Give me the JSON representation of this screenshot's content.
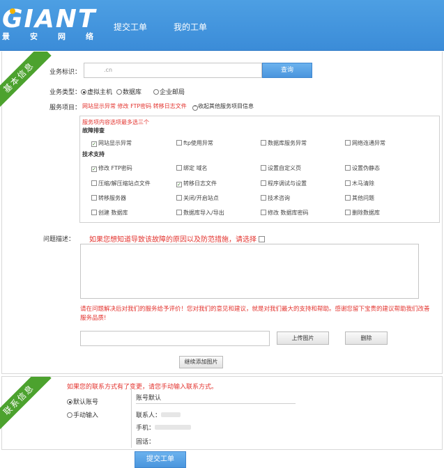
{
  "header": {
    "logo_text": "GIANT",
    "logo_sub": "景安网络",
    "nav": [
      "提交工单",
      "我的工单"
    ]
  },
  "basic": {
    "ribbon": "基本信息",
    "biz_id_label": "业务标识：",
    "biz_id_value": ".cn",
    "query_button": "查询",
    "biz_type_label": "业务类型：",
    "biz_types": [
      {
        "label": "虚拟主机",
        "checked": true
      },
      {
        "label": "数据库",
        "checked": false
      },
      {
        "label": "企业邮局",
        "checked": false
      }
    ],
    "service_label": "服务项目：",
    "service_selected": "网站显示异常 修改 FTP密码 转移日志文件",
    "service_collapse": "收起其他服务项目信息",
    "service_hint": "服务项内容选项最多选三个",
    "group_fault": "故障排查",
    "group_tech": "技术支持",
    "fault_items": [
      {
        "label": "网站显示异常",
        "checked": true
      },
      {
        "label": "ftp使用异常",
        "checked": false
      },
      {
        "label": "数据库服务异常",
        "checked": false
      },
      {
        "label": "网络连通异常",
        "checked": false
      }
    ],
    "tech_items": [
      {
        "label": "修改 FTP密码",
        "checked": true
      },
      {
        "label": "绑定 域名",
        "checked": false
      },
      {
        "label": "设置自定义页",
        "checked": false
      },
      {
        "label": "设置伪静态",
        "checked": false
      },
      {
        "label": "压缩/解压缩站点文件",
        "checked": false
      },
      {
        "label": "转移日志文件",
        "checked": true
      },
      {
        "label": "程序调试与设置",
        "checked": false
      },
      {
        "label": "木马清除",
        "checked": false
      },
      {
        "label": "转移服务器",
        "checked": false
      },
      {
        "label": "关闭/开启站点",
        "checked": false
      },
      {
        "label": "技术咨询",
        "checked": false
      },
      {
        "label": "其他问题",
        "checked": false
      },
      {
        "label": "创建 数据库",
        "checked": false
      },
      {
        "label": "数据库导入/导出",
        "checked": false
      },
      {
        "label": "修改 数据库密码",
        "checked": false
      },
      {
        "label": "删除数据库",
        "checked": false
      }
    ],
    "problem_label": "问题描述：",
    "problem_hint": "如果您想知道导致该故障的原因以及防范措施，请选择",
    "feedback_note": "请在问题解决后对我们的服务给予评价！您对我们的意见和建议，就是对我们最大的支持和帮助。感谢您留下宝贵的建议帮助我们改善服务品质!",
    "upload_button": "上传图片",
    "delete_button": "删除",
    "add_image_button": "继续添加图片"
  },
  "contact": {
    "ribbon": "联系信息",
    "note": "如果您的联系方式有了变更，请您手动输入联系方式。",
    "options": [
      {
        "label": "默认账号",
        "checked": true
      },
      {
        "label": "手动输入",
        "checked": false
      }
    ],
    "account_default": "账号默认",
    "contact_person": "联系人：",
    "phone": "手机：",
    "tel": "固话："
  },
  "submit_button": "提交工单"
}
